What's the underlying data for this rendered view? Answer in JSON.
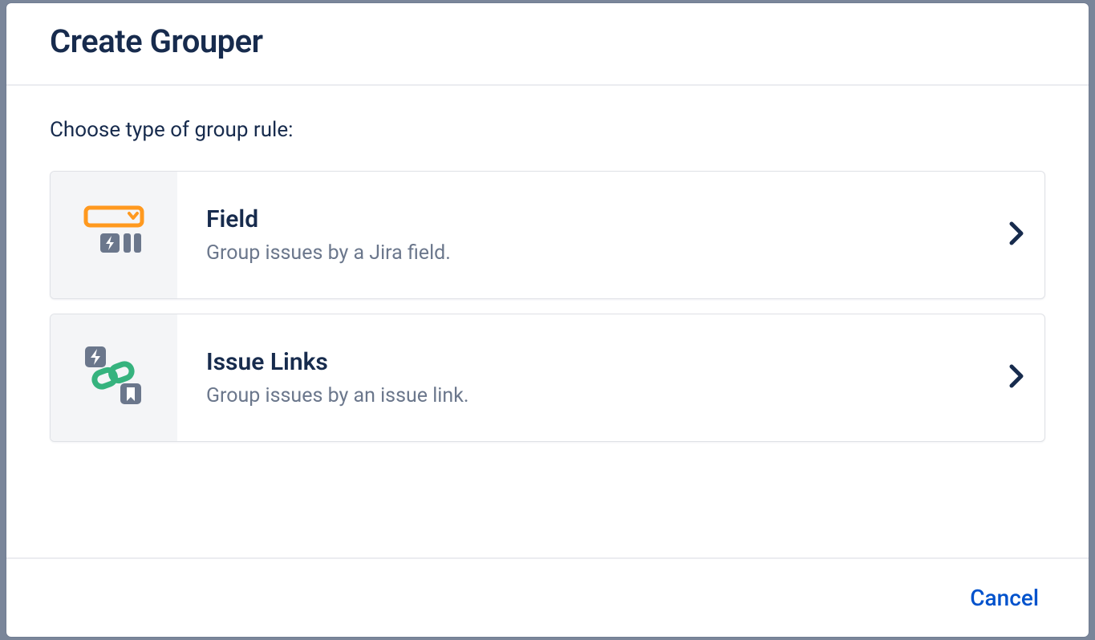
{
  "modal": {
    "title": "Create Grouper",
    "prompt": "Choose type of group rule:",
    "options": [
      {
        "title": "Field",
        "description": "Group issues by a Jira field."
      },
      {
        "title": "Issue Links",
        "description": "Group issues by an issue link."
      }
    ],
    "cancel_label": "Cancel"
  }
}
